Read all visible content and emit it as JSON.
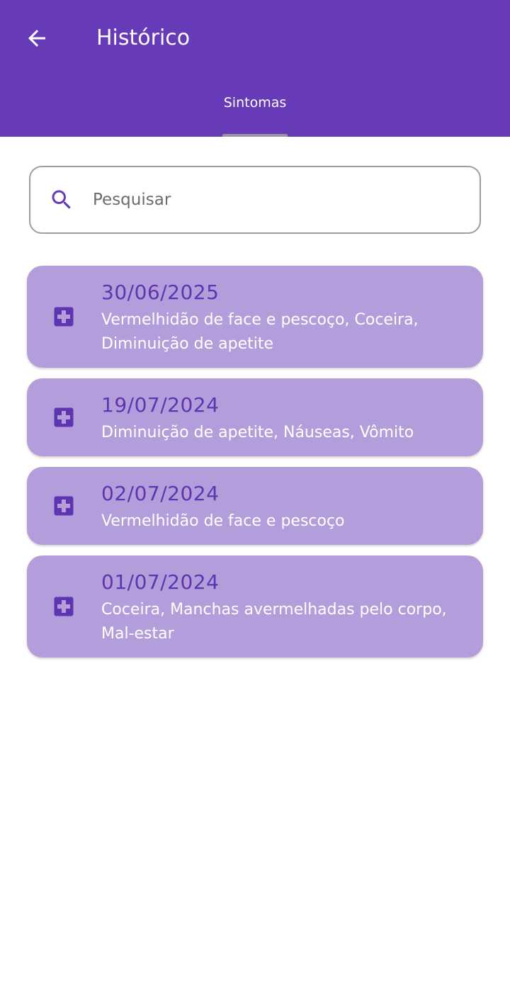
{
  "header": {
    "back_icon": "arrow-left-icon",
    "title": "Histórico",
    "tab_label": "Sintomas"
  },
  "search": {
    "icon": "search-icon",
    "placeholder": "Pesquisar",
    "value": ""
  },
  "entries": [
    {
      "icon": "medical-plus-icon",
      "date": "30/06/2025",
      "symptoms": "Vermelhidão de face e pescoço, Coceira, Diminuição de apetite"
    },
    {
      "icon": "medical-plus-icon",
      "date": "19/07/2024",
      "symptoms": "Diminuição de apetite, Náuseas, Vômito"
    },
    {
      "icon": "medical-plus-icon",
      "date": "02/07/2024",
      "symptoms": "Vermelhidão de face e pescoço"
    },
    {
      "icon": "medical-plus-icon",
      "date": "01/07/2024",
      "symptoms": "Coceira, Manchas avermelhadas pelo corpo, Mal-estar"
    }
  ],
  "colors": {
    "primary": "#673ab7",
    "card_background": "#b39ddb",
    "date_text": "#5e35b1",
    "icon": "#5e35b1"
  }
}
